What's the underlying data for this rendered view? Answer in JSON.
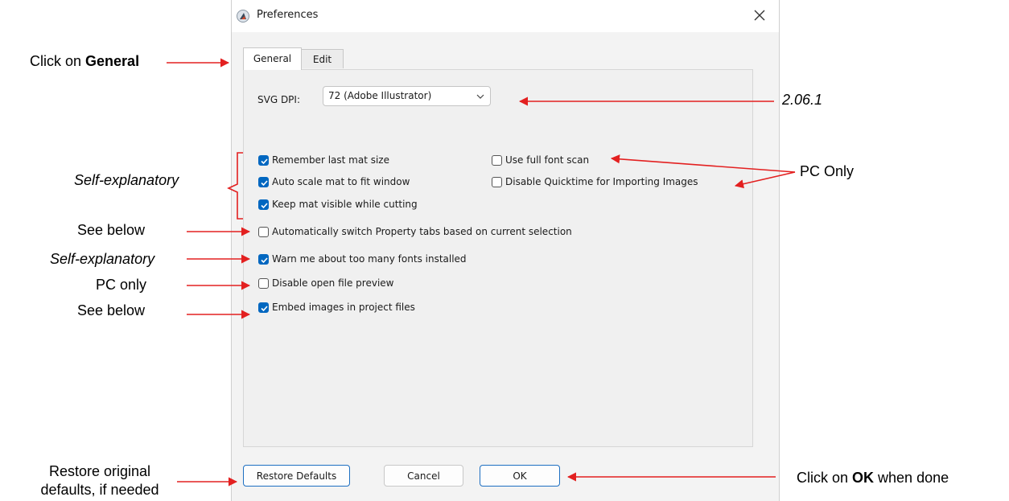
{
  "dialog": {
    "title": "Preferences",
    "tabs": [
      {
        "label": "General",
        "active": true
      },
      {
        "label": "Edit",
        "active": false
      }
    ],
    "svg_dpi": {
      "label": "SVG DPI:",
      "selected": "72 (Adobe Illustrator)"
    },
    "options": [
      {
        "label": "Remember last mat size",
        "checked": true
      },
      {
        "label": "Auto scale mat to fit window",
        "checked": true
      },
      {
        "label": "Keep mat visible while cutting",
        "checked": true
      },
      {
        "label": "Use full font scan",
        "checked": false
      },
      {
        "label": "Disable Quicktime for Importing Images",
        "checked": false
      },
      {
        "label": "Automatically switch Property tabs based on current selection",
        "checked": false
      },
      {
        "label": "Warn me about too many fonts installed",
        "checked": true
      },
      {
        "label": "Disable open file preview",
        "checked": false
      },
      {
        "label": "Embed images in project files",
        "checked": true
      }
    ],
    "buttons": {
      "restore": "Restore Defaults",
      "cancel": "Cancel",
      "ok": "OK"
    }
  },
  "annotations": {
    "general_prefix": "Click on ",
    "general_bold": "General",
    "version": "2.06.1",
    "self_explanatory": "Self-explanatory",
    "pc_only_cap": "PC Only",
    "see_below": "See below",
    "pc_only": "PC only",
    "restore_line1": "Restore original",
    "restore_line2": "defaults, if needed",
    "ok_prefix": "Click on ",
    "ok_bold": "OK",
    "ok_suffix": " when done"
  },
  "colors": {
    "arrow": "#e32020",
    "checkbox_accent": "#0067c0"
  }
}
